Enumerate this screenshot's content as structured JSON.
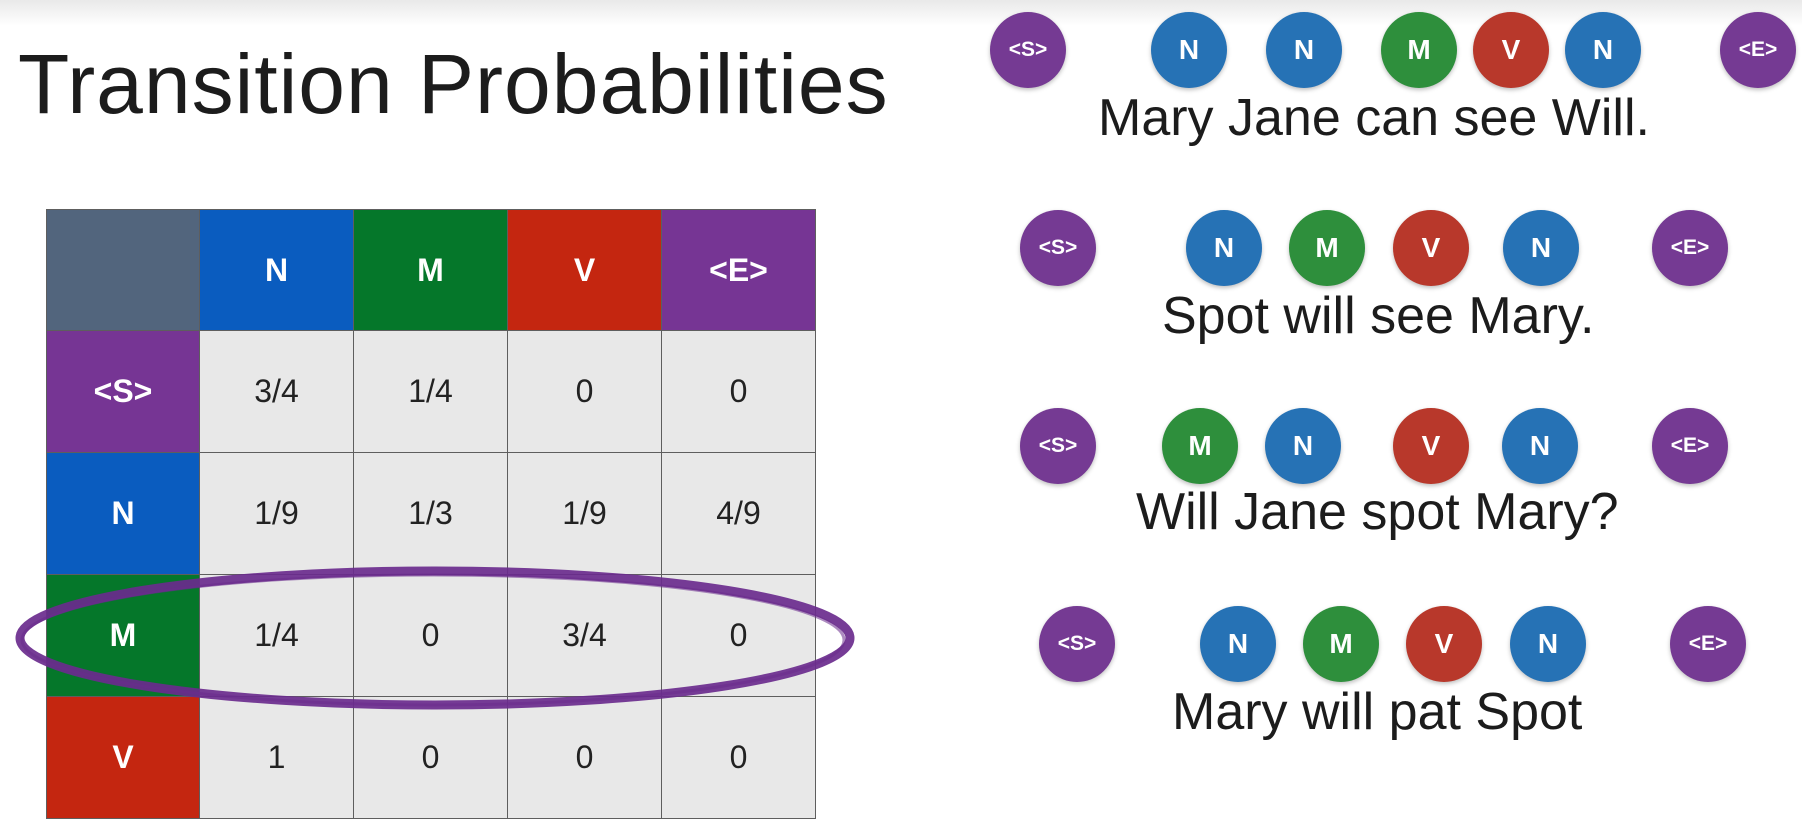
{
  "title": "Transition Probabilities",
  "colors": {
    "corner": "#52657d",
    "S": "#763594",
    "N": "#0a5cbf",
    "M": "#05772a",
    "V": "#c42610",
    "E": "#763594",
    "ellipse": "#6a2b8d",
    "node_S": "#753a93",
    "node_N": "#2672b5",
    "node_M": "#2e8f3c",
    "node_V": "#b8382b",
    "node_E": "#753a93"
  },
  "table": {
    "columns": [
      "N",
      "M",
      "V",
      "<E>"
    ],
    "rows": [
      {
        "label": "<S>",
        "values": [
          "3/4",
          "1/4",
          "0",
          "0"
        ]
      },
      {
        "label": "N",
        "values": [
          "1/9",
          "1/3",
          "1/9",
          "4/9"
        ]
      },
      {
        "label": "M",
        "values": [
          "1/4",
          "0",
          "3/4",
          "0"
        ]
      },
      {
        "label": "V",
        "values": [
          "1",
          "0",
          "0",
          "0"
        ]
      }
    ],
    "highlighted_row": "M"
  },
  "sentences": [
    {
      "text": "Mary Jane can see Will.",
      "tags": [
        "<S>",
        "N",
        "N",
        "M",
        "V",
        "N",
        "<E>"
      ]
    },
    {
      "text": "Spot will see Mary.",
      "tags": [
        "<S>",
        "N",
        "M",
        "V",
        "N",
        "<E>"
      ]
    },
    {
      "text": "Will Jane spot Mary?",
      "tags": [
        "<S>",
        "M",
        "N",
        "V",
        "N",
        "<E>"
      ]
    },
    {
      "text": "Mary will pat Spot",
      "tags": [
        "<S>",
        "N",
        "M",
        "V",
        "N",
        "<E>"
      ]
    }
  ]
}
